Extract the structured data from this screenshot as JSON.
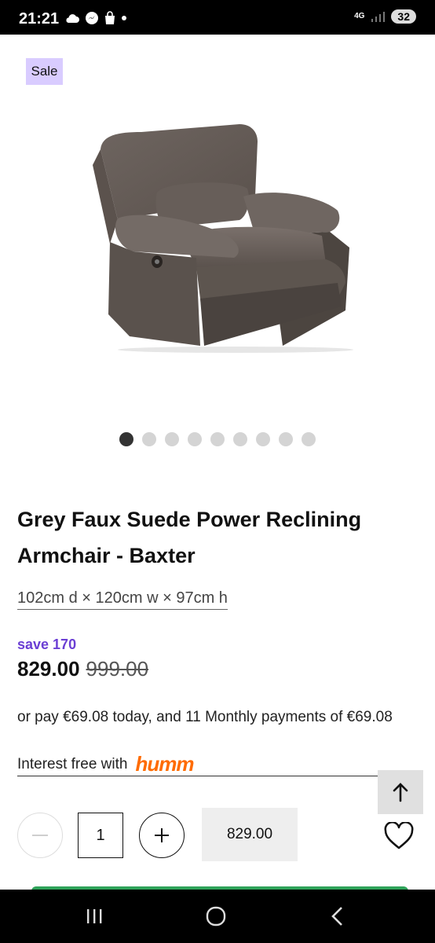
{
  "status_bar": {
    "time": "21:21",
    "network": "4G",
    "battery": "32",
    "icons_left": [
      "cloud-icon",
      "messenger-icon",
      "shopping-bag-icon",
      "dot-icon"
    ],
    "icons_right": [
      "network-4g-icon",
      "signal-icon",
      "battery-icon"
    ]
  },
  "product": {
    "badge": "Sale",
    "title": "Grey Faux Suede Power Reclining Armchair - Baxter",
    "dimensions": "102cm d × 120cm w × 97cm h",
    "save": "save 170",
    "price": "829.00",
    "was_price": "999.00",
    "image_icon": "armchair-image",
    "carousel": {
      "total": 9,
      "active_index": 0
    }
  },
  "finance": {
    "text": "or pay €69.08 today, and 11 Monthly payments of €69.08",
    "interest_label": "Interest free with",
    "provider_logo_text": "humm"
  },
  "actions": {
    "back_to_top_icon": "arrow-up-icon",
    "decrease_icon": "minus-icon",
    "increase_icon": "plus-icon",
    "quantity": "1",
    "total": "829.00",
    "wishlist_icon": "heart-icon"
  },
  "navigation": {
    "buttons": [
      "recent-apps-icon",
      "home-icon",
      "back-icon"
    ]
  },
  "colors": {
    "accent_purple": "#6b3fd4",
    "sale_badge": "#d9ccff",
    "humm_orange": "#ff6b00",
    "cta_green": "#2fa35a"
  }
}
